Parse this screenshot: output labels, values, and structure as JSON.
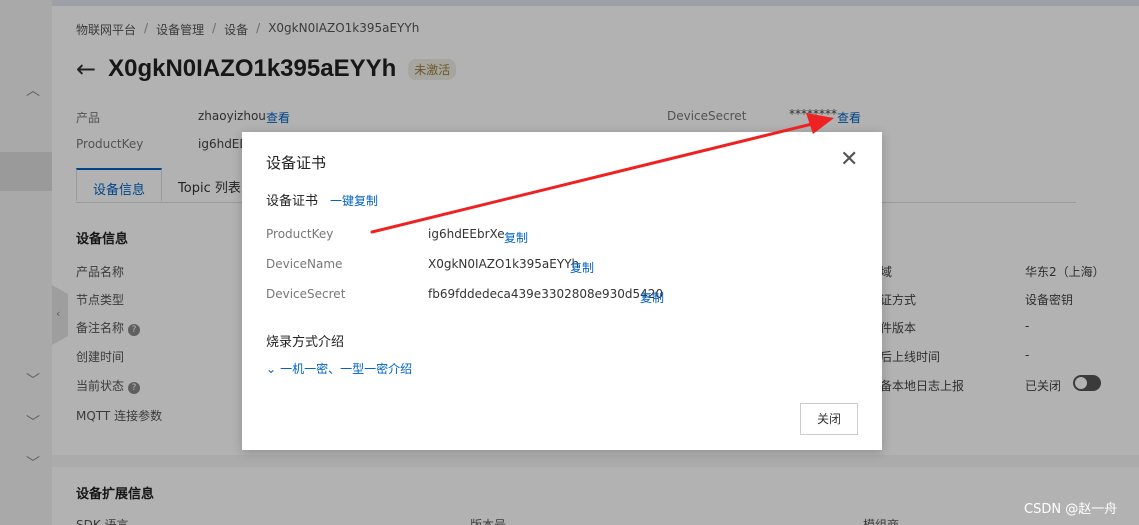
{
  "breadcrumb": [
    "物联网平台",
    "设备管理",
    "设备",
    "X0gkN0IAZO1k395aEYYh"
  ],
  "breadcrumb_sep": "/",
  "device": {
    "name": "X0gkN0IAZO1k395aEYYh",
    "status": "未激活"
  },
  "header_info": {
    "product_label": "产品",
    "product_value": "zhaoyizhou",
    "product_link": "查看",
    "productkey_label": "ProductKey",
    "productkey_value": "ig6hdEE",
    "devicesecret_label": "DeviceSecret",
    "devicesecret_value": "********",
    "devicesecret_link": "查看"
  },
  "tabs": [
    "设备信息",
    "Topic 列表"
  ],
  "device_info": {
    "title": "设备信息",
    "rows": [
      "产品名称",
      "节点类型",
      "备注名称",
      "创建时间",
      "当前状态",
      "MQTT 连接参数"
    ],
    "right_rows": [
      {
        "label": "域",
        "value": "华东2（上海）"
      },
      {
        "label": "证方式",
        "value": "设备密钥"
      },
      {
        "label": "件版本",
        "value": "-"
      },
      {
        "label": "后上线时间",
        "value": "-"
      },
      {
        "label": "备本地日志上报",
        "value": "已关闭"
      }
    ]
  },
  "ext_info": {
    "title": "设备扩展信息",
    "cols": [
      "SDK 语言",
      "版本号",
      "模组商"
    ]
  },
  "modal": {
    "title": "设备证书",
    "cert_title": "设备证书",
    "copy_all": "一键复制",
    "fields": [
      {
        "label": "ProductKey",
        "value": "ig6hdEEbrXe",
        "copy": "复制"
      },
      {
        "label": "DeviceName",
        "value": "X0gkN0IAZO1k395aEYYh",
        "copy": "复制"
      },
      {
        "label": "DeviceSecret",
        "value": "fb69fddedeca439e3302808e930d5420",
        "copy": "复制"
      }
    ],
    "burn_title": "烧录方式介绍",
    "burn_link": "一机一密、一型一密介绍",
    "close_button": "关闭"
  },
  "watermark": "CSDN @赵一舟",
  "colors": {
    "link": "#0063c6",
    "arrow": "#ee2222",
    "status_tag_bg": "#f0ede4"
  }
}
